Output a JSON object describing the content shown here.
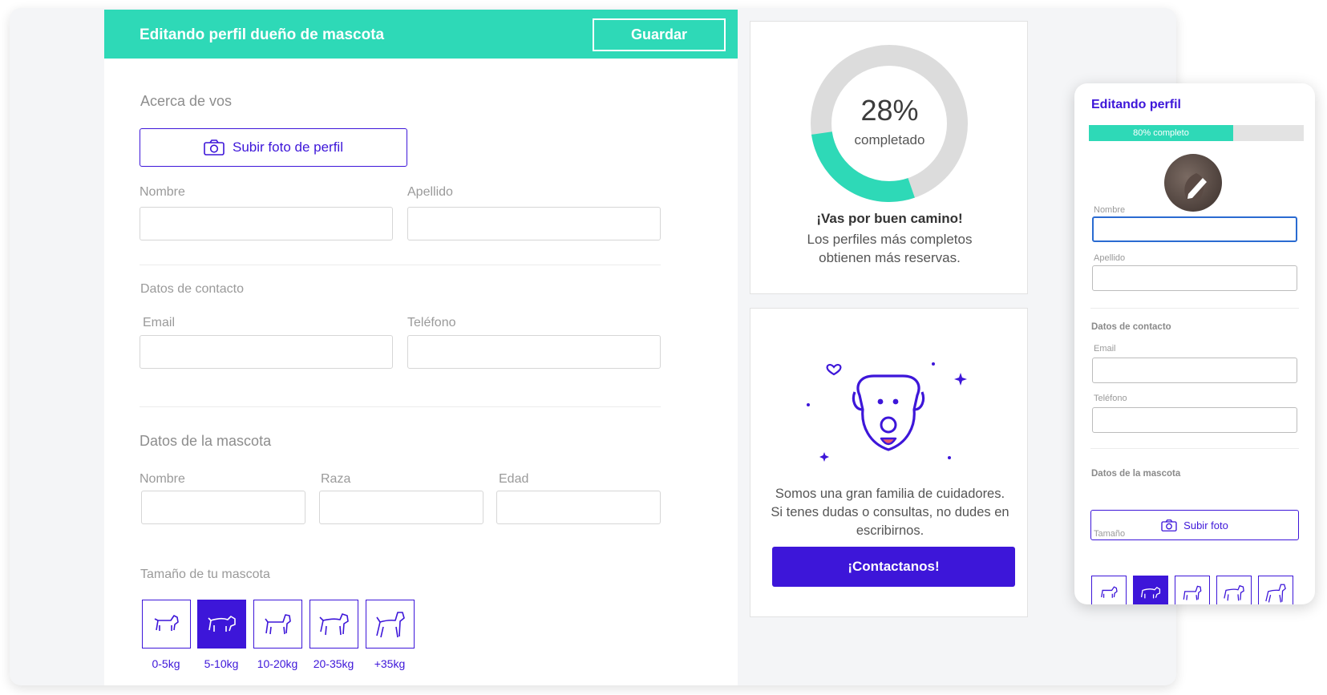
{
  "header": {
    "title": "Editando perfil dueño de mascota",
    "save_label": "Guardar"
  },
  "about": {
    "section_title": "Acerca de vos",
    "upload_label": "Subir foto de perfil",
    "first_name_label": "Nombre",
    "first_name_value": "",
    "last_name_label": "Apellido",
    "last_name_value": ""
  },
  "contact": {
    "section_title": "Datos de contacto",
    "email_label": "Email",
    "email_value": "",
    "phone_label": "Teléfono",
    "phone_value": ""
  },
  "pet": {
    "section_title": "Datos de la mascota",
    "name_label": "Nombre",
    "breed_label": "Raza",
    "age_label": "Edad",
    "size_title": "Tamaño de tu mascota",
    "sizes": [
      {
        "label": "0-5kg",
        "selected": false
      },
      {
        "label": "5-10kg",
        "selected": true
      },
      {
        "label": "10-20kg",
        "selected": false
      },
      {
        "label": "20-35kg",
        "selected": false
      },
      {
        "label": "+35kg",
        "selected": false
      }
    ]
  },
  "progress": {
    "percent_text": "28%",
    "percent_value": 0.28,
    "subtitle": "completado",
    "title": "¡Vas por buen camino!",
    "text": "Los perfiles más completos obtienen más reservas."
  },
  "help": {
    "text": "Somos una gran familia de cuidadores. Si tenes dudas o consultas, no dudes en escribirnos.",
    "button_label": "¡Contactanos!"
  },
  "mobile": {
    "title": "Editando perfil",
    "progress_text": "80% completo",
    "progress_value": 0.8,
    "first_name_label": "Nombre",
    "last_name_label": "Apellido",
    "contact_section": "Datos de contacto",
    "email_label": "Email",
    "phone_label": "Teléfono",
    "pet_section": "Datos de la mascota",
    "upload_label": "Subir foto",
    "size_label": "Tamaño"
  },
  "colors": {
    "accent_teal": "#2ed9b7",
    "accent_purple": "#3d16d9",
    "focus_blue": "#2a6bd1"
  }
}
